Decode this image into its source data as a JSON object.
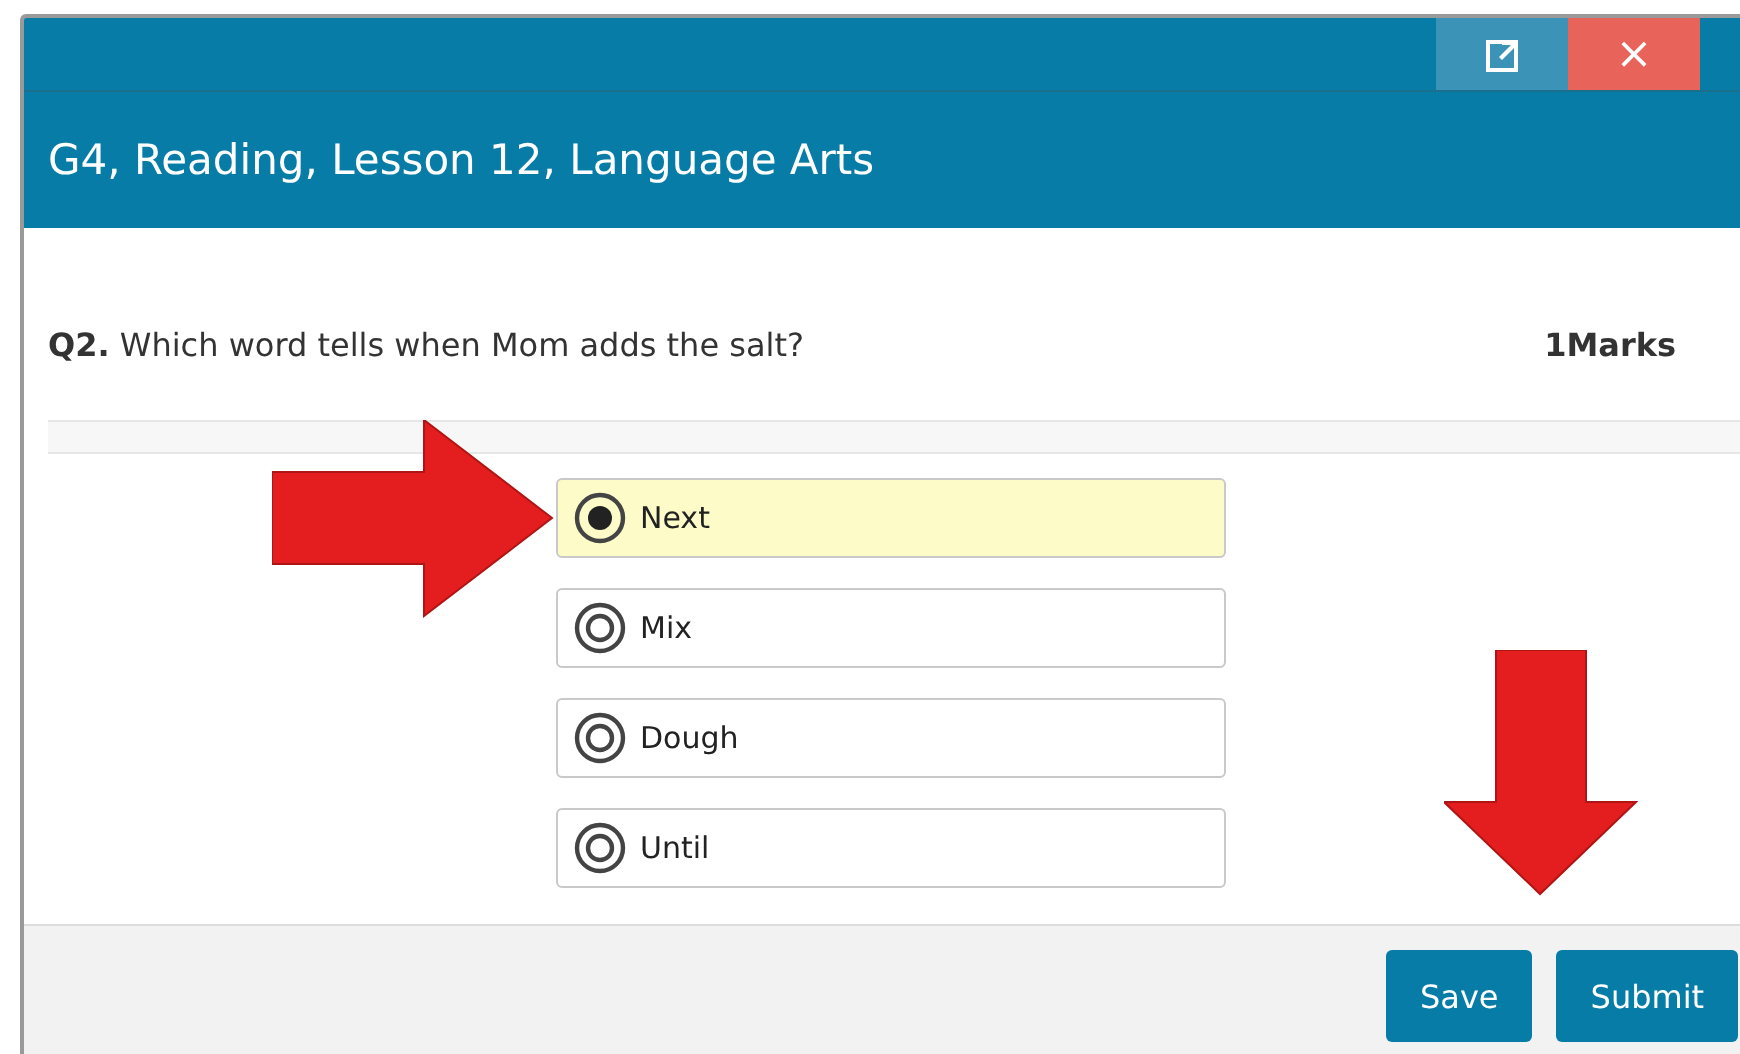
{
  "window": {
    "title": "G4, Reading, Lesson 12, Language Arts",
    "controls": [
      "×"
    ]
  },
  "question": {
    "number": "Q2.",
    "text": "Which word tells when Mom adds the salt?",
    "marks": "1Marks"
  },
  "options": [
    {
      "label": "Next",
      "selected": true
    },
    {
      "label": "Mix",
      "selected": false
    },
    {
      "label": "Dough",
      "selected": false
    },
    {
      "label": "Until",
      "selected": false
    }
  ],
  "buttons": [
    "Save",
    "Submit"
  ]
}
